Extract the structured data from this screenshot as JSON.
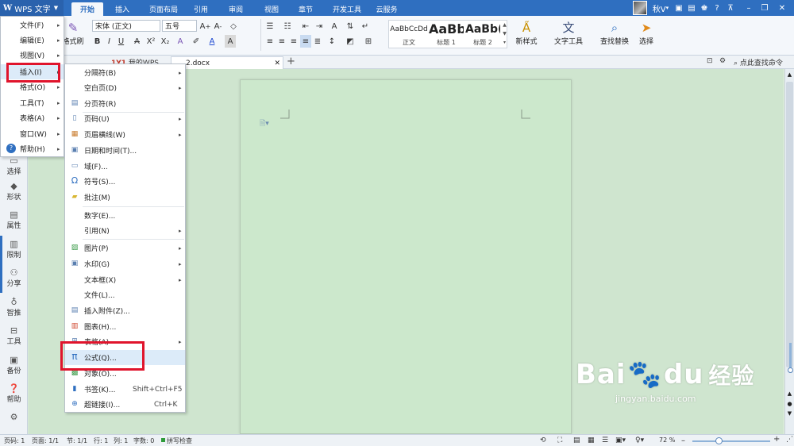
{
  "app": {
    "name": "WPS 文字"
  },
  "ribbon_tabs": [
    "开始",
    "插入",
    "页面布局",
    "引用",
    "审阅",
    "视图",
    "章节",
    "开发工具",
    "云服务"
  ],
  "user": {
    "name": "秋V"
  },
  "ribbon": {
    "format_painter": "格式刷",
    "font_name": "宋体 (正文)",
    "font_size": "五号",
    "styles": [
      {
        "sample": "AaBbCcDd",
        "label": "正文"
      },
      {
        "sample": "AaBb",
        "label": "标题 1"
      },
      {
        "sample": "AaBb(",
        "label": "标题 2"
      }
    ],
    "new_style": "新样式",
    "text_tool": "文字工具",
    "find_replace": "查找替换",
    "select": "选择"
  },
  "doc_tabs": {
    "mywps": "我的WPS",
    "doc": "2.docx"
  },
  "search_cmd": "点此查找命令",
  "left_bar": [
    "选择",
    "形状",
    "属性",
    "限制",
    "分享",
    "智推",
    "工具",
    "备份",
    "帮助"
  ],
  "app_menu": [
    {
      "label": "文件(F)"
    },
    {
      "label": "编辑(E)"
    },
    {
      "label": "视图(V)"
    },
    {
      "label": "插入(I)"
    },
    {
      "label": "格式(O)"
    },
    {
      "label": "工具(T)"
    },
    {
      "label": "表格(A)"
    },
    {
      "label": "窗口(W)"
    },
    {
      "label": "帮助(H)"
    }
  ],
  "insert_menu": [
    {
      "label": "分隔符(B)",
      "icon": "none"
    },
    {
      "label": "空白页(D)",
      "icon": "none"
    },
    {
      "label": "分页符(R)",
      "icon": "page-break-icon"
    },
    {
      "label": "页码(U)",
      "icon": "page-number-icon"
    },
    {
      "label": "页眉横线(W)",
      "icon": "header-line-icon"
    },
    {
      "label": "日期和时间(T)...",
      "icon": "calendar-icon"
    },
    {
      "label": "域(F)...",
      "icon": "field-icon"
    },
    {
      "label": "符号(S)...",
      "icon": "omega-icon"
    },
    {
      "label": "批注(M)",
      "icon": "comment-icon"
    },
    {
      "label": "数字(E)...",
      "icon": "none"
    },
    {
      "label": "引用(N)",
      "icon": "none"
    },
    {
      "label": "图片(P)",
      "icon": "picture-icon"
    },
    {
      "label": "水印(G)",
      "icon": "watermark-icon"
    },
    {
      "label": "文本框(X)",
      "icon": "none"
    },
    {
      "label": "文件(L)...",
      "icon": "none"
    },
    {
      "label": "插入附件(Z)...",
      "icon": "attachment-icon"
    },
    {
      "label": "图表(H)...",
      "icon": "chart-icon"
    },
    {
      "label": "表格(A)",
      "icon": "table-icon"
    },
    {
      "label": "公式(Q)...",
      "icon": "pi-icon"
    },
    {
      "label": "对象(O)...",
      "icon": "object-icon"
    },
    {
      "label": "书签(K)...",
      "icon": "bookmark-icon",
      "shortcut": "Shift+Ctrl+F5"
    },
    {
      "label": "超链接(I)...",
      "icon": "hyperlink-icon",
      "shortcut": "Ctrl+K"
    }
  ],
  "status": {
    "page": "页码: 1",
    "pages": "页面: 1/1",
    "section": "节: 1/1",
    "row": "行: 1",
    "col": "列: 1",
    "words": "字数: 0",
    "spell": "拼写检查",
    "zoom": "72 %"
  },
  "watermark": {
    "brand": "Bai",
    "brand2": "du",
    "cn": "经验",
    "url": "jingyan.baidu.com"
  },
  "colors": {
    "accent": "#2f6fc0",
    "highlight_box": "#e0142c",
    "page_bg": "#cce8cc"
  }
}
